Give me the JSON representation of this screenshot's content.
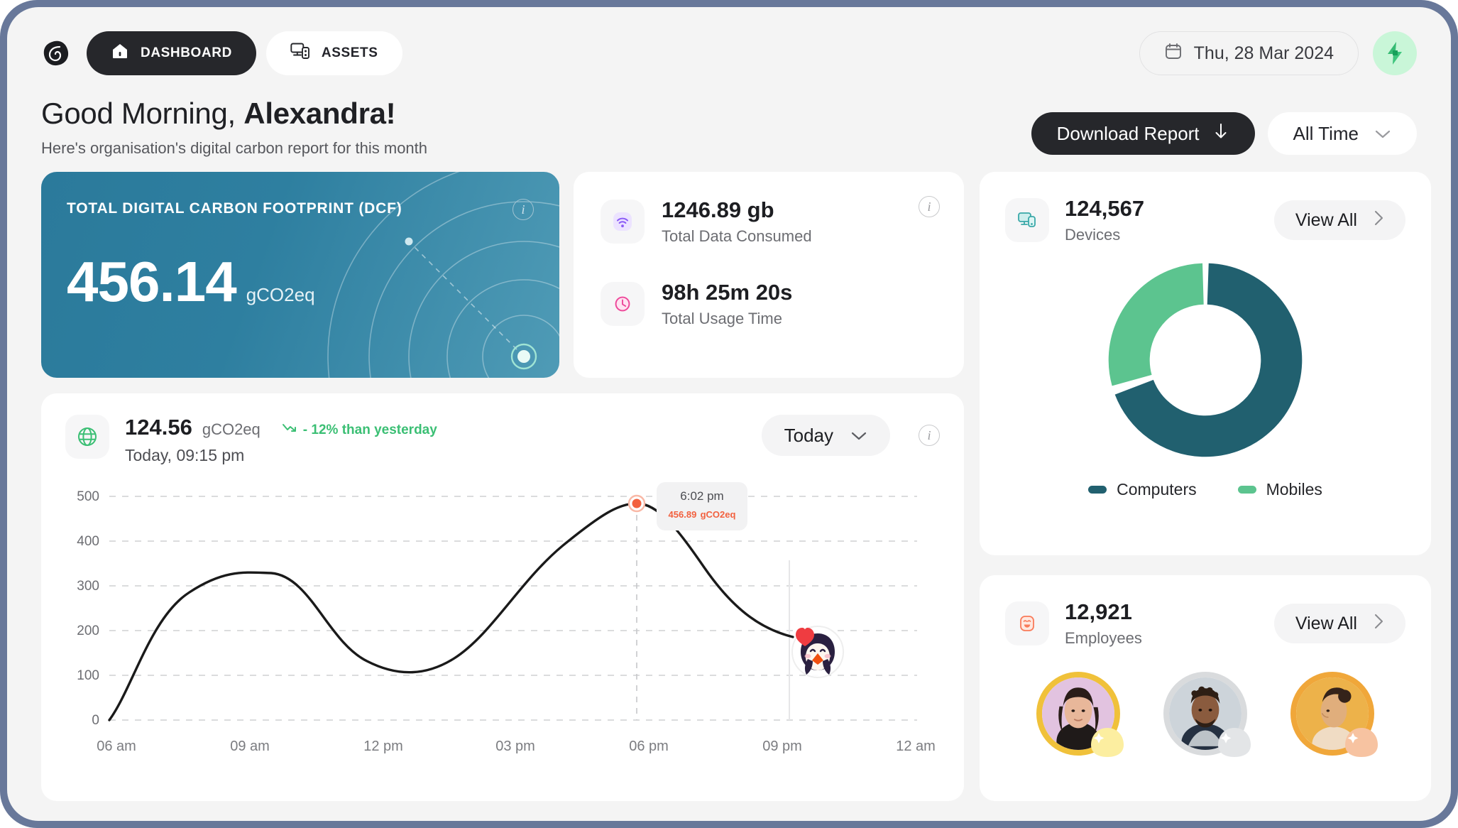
{
  "nav": {
    "logo_icon": "leaf-logo-icon",
    "items": [
      {
        "label": "DASHBOARD",
        "icon": "home-icon",
        "active": true
      },
      {
        "label": "ASSETS",
        "icon": "assets-monitor-icon",
        "active": false
      }
    ],
    "date": "Thu, 28 Mar 2024",
    "date_icon": "calendar-icon",
    "bolt_icon": "lightning-bolt-icon"
  },
  "greeting": {
    "prefix": "Good Morning, ",
    "name": "Alexandra!",
    "subtitle": "Here's organisation's digital carbon report for this month"
  },
  "header_actions": {
    "download_label": "Download Report",
    "download_icon": "arrow-down-icon",
    "range_label": "All Time",
    "range_icon": "chevron-down-icon"
  },
  "dcf": {
    "label": "TOTAL DIGITAL CARBON FOOTPRINT (DCF)",
    "value": "456.14",
    "unit": "gCO2eq",
    "info_icon": "info-icon"
  },
  "stats": {
    "info_icon": "info-icon",
    "rows": [
      {
        "value": "1246.89 gb",
        "label": "Total Data Consumed",
        "icon": "wifi-icon",
        "icon_color": "#a78bfa"
      },
      {
        "value": "98h 25m 20s",
        "label": "Total Usage Time",
        "icon": "clock-icon",
        "icon_color": "#ec4899"
      }
    ]
  },
  "devices": {
    "count": "124,567",
    "label": "Devices",
    "icon": "device-monitor-icon",
    "icon_color": "#5eb5b5",
    "view_all": "View All",
    "view_all_icon": "chevron-right-icon"
  },
  "employees": {
    "count": "12,921",
    "label": "Employees",
    "icon": "smiley-face-icon",
    "icon_color": "#f97b5a",
    "view_all": "View All",
    "view_all_icon": "chevron-right-icon",
    "avatar_rings": [
      "#f0c13a",
      "#d9dbdd",
      "#f0a73a"
    ]
  },
  "chart_panel": {
    "value": "124.56",
    "unit": "gCO2eq",
    "delta": "- 12% than yesterday",
    "delta_icon": "trend-down-icon",
    "delta_color": "#3bbf74",
    "timestamp": "Today, 09:15 pm",
    "range_label": "Today",
    "range_icon": "chevron-down-icon",
    "info_icon": "info-icon",
    "globe_icon": "globe-icon",
    "tooltip_time": "6:02 pm",
    "tooltip_value": "456.89",
    "tooltip_unit": "gCO2eq",
    "penguin_icon": "penguin-heart-avatar-icon"
  },
  "chart_data": [
    {
      "type": "line",
      "title": "Digital carbon footprint over the day",
      "xlabel": "",
      "ylabel": "gCO2eq",
      "x": [
        "06 am",
        "09 am",
        "12 pm",
        "03 pm",
        "06 pm",
        "09 pm",
        "12 am"
      ],
      "xtick_labels": [
        "06 am",
        "09 am",
        "12 pm",
        "03 pm",
        "06 pm",
        "09 pm",
        "12 am"
      ],
      "ytick_labels": [
        "0",
        "100",
        "200",
        "300",
        "400",
        "500"
      ],
      "ylim": [
        0,
        500
      ],
      "grid": true,
      "legend": "none",
      "series": [
        {
          "name": "gCO2eq",
          "color": "#1a1a1a",
          "points": [
            {
              "t": "06:00 am",
              "v": 0
            },
            {
              "t": "07:30 am",
              "v": 190
            },
            {
              "t": "09:00 am",
              "v": 330
            },
            {
              "t": "10:30 am",
              "v": 290
            },
            {
              "t": "12:00 pm",
              "v": 195
            },
            {
              "t": "01:30 pm",
              "v": 140
            },
            {
              "t": "03:00 pm",
              "v": 215
            },
            {
              "t": "04:30 pm",
              "v": 350
            },
            {
              "t": "06:02 pm",
              "v": 456.89
            },
            {
              "t": "07:30 pm",
              "v": 340
            },
            {
              "t": "09:00 pm",
              "v": 222
            }
          ]
        }
      ],
      "highlight": {
        "x": "06:02 pm",
        "y": 456.89,
        "label_time": "6:02 pm",
        "label_value": "456.89 gCO2eq",
        "color": "#f2613f"
      }
    },
    {
      "type": "pie",
      "title": "Devices",
      "labels": [
        "Computers",
        "Mobiles"
      ],
      "values": [
        70,
        30
      ],
      "colors": [
        "#21606f",
        "#5cc48f"
      ],
      "donut": true,
      "legend": "bottom"
    }
  ]
}
